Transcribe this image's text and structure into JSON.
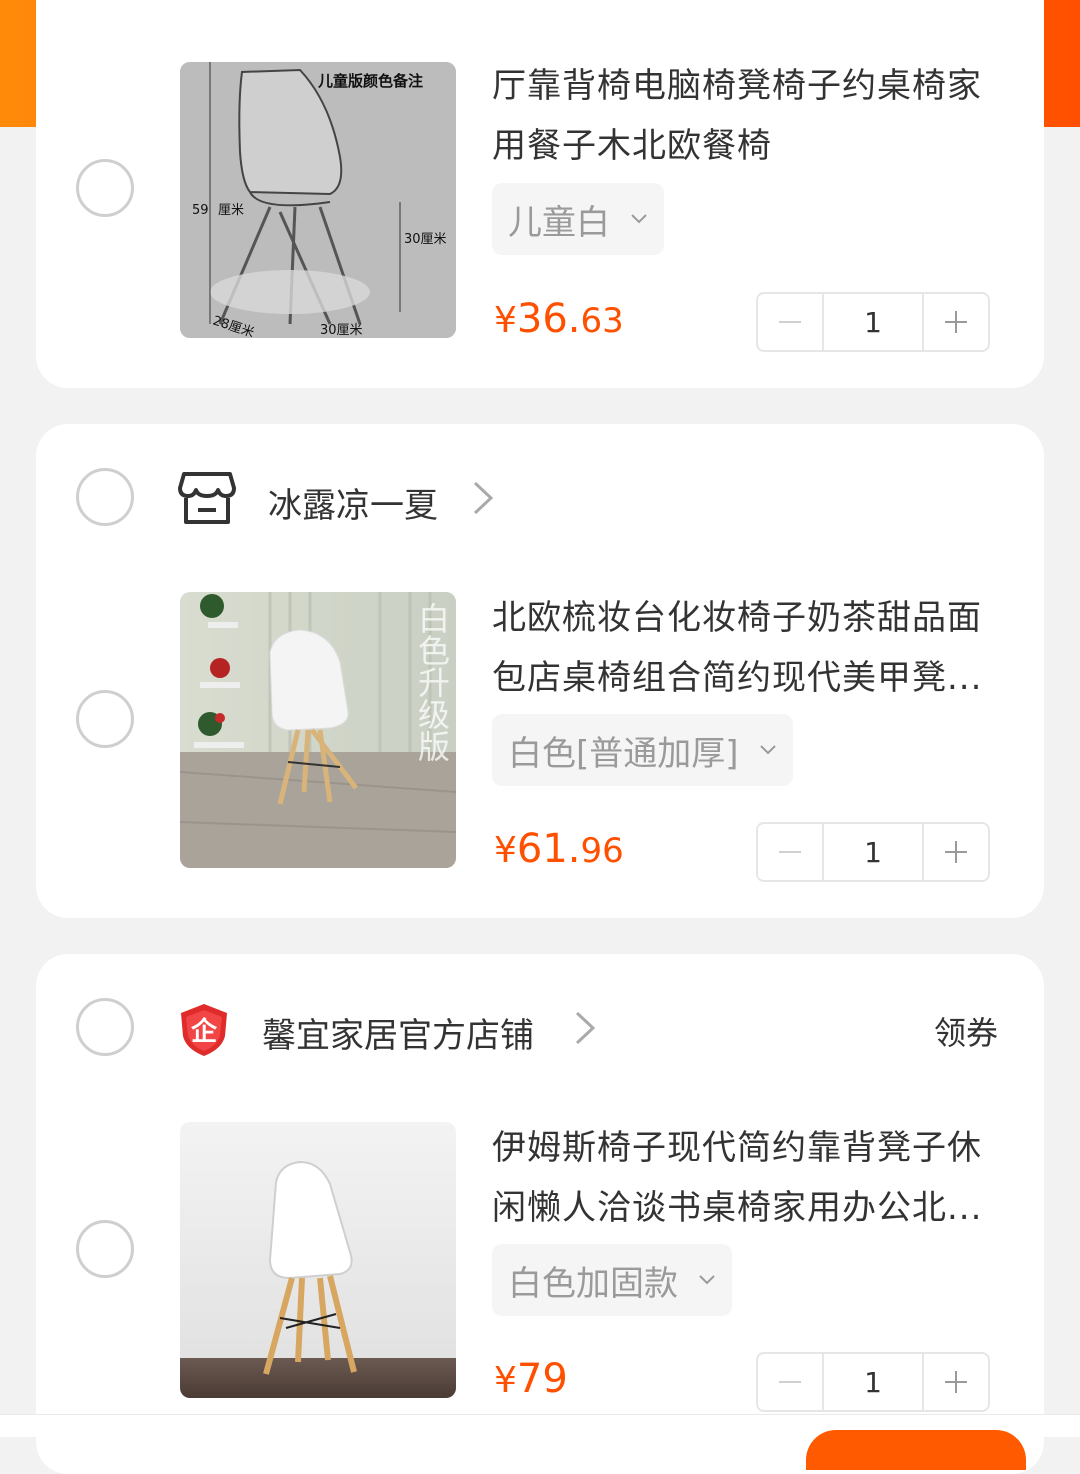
{
  "colors": {
    "accent": "#ff5000",
    "header_gradient_start": "#ff8a0a",
    "header_gradient_end": "#ff5000"
  },
  "items": [
    {
      "title": "厅靠背椅电脑椅凳椅子约桌椅家用餐子木北欧餐椅",
      "sku": "儿童白",
      "price_currency": "¥",
      "price_int": "36.",
      "price_dec": "63",
      "quantity": "1",
      "image_labels": [
        "儿童版颜色备注",
        "59",
        "厘米",
        "30厘米",
        "28厘米",
        "30厘米"
      ]
    },
    {
      "store": {
        "name": "冰露凉一夏",
        "icon": "shop-icon"
      },
      "title": "北欧梳妆台化妆椅子奶茶甜品面包店桌椅组合简约现代美甲凳...",
      "sku": "白色[普通加厚]",
      "price_currency": "¥",
      "price_int": "61.",
      "price_dec": "96",
      "quantity": "1",
      "image_labels": [
        "白色升级版"
      ]
    },
    {
      "store": {
        "name": "馨宜家居官方店铺",
        "icon": "enterprise-shield-icon",
        "badge": "企",
        "coupon": "领券"
      },
      "title": "伊姆斯椅子现代简约靠背凳子休闲懒人洽谈书桌椅家用办公北...",
      "sku": "白色加固款",
      "price_currency": "¥",
      "price_int": "79",
      "price_dec": "",
      "quantity": "1"
    }
  ]
}
